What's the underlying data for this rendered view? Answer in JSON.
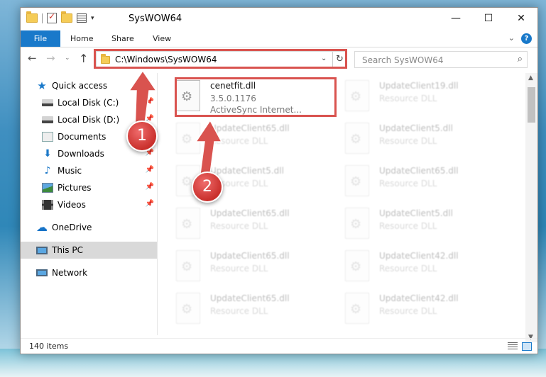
{
  "window": {
    "title": "SysWOW64",
    "controls": {
      "minimize": "—",
      "maximize": "☐",
      "close": "✕"
    }
  },
  "ribbon": {
    "tabs": [
      "File",
      "Home",
      "Share",
      "View"
    ],
    "help": "?"
  },
  "navbar": {
    "address": "C:\\Windows\\SysWOW64",
    "search_placeholder": "Search SysWOW64",
    "icons": [
      "back-arrow-icon",
      "forward-arrow-icon",
      "recent-locations-icon",
      "up-arrow-icon",
      "refresh-icon",
      "search-icon"
    ]
  },
  "sidebar": {
    "items": [
      {
        "label": "Quick access",
        "icon": "star-icon",
        "pinned": false
      },
      {
        "label": "Local Disk (C:)",
        "icon": "drive-icon",
        "pinned": true
      },
      {
        "label": "Local Disk (D:)",
        "icon": "drive-icon",
        "pinned": true
      },
      {
        "label": "Documents",
        "icon": "documents-icon",
        "pinned": true
      },
      {
        "label": "Downloads",
        "icon": "downloads-icon",
        "pinned": true
      },
      {
        "label": "Music",
        "icon": "music-icon",
        "pinned": true
      },
      {
        "label": "Pictures",
        "icon": "pictures-icon",
        "pinned": true
      },
      {
        "label": "Videos",
        "icon": "videos-icon",
        "pinned": true
      },
      {
        "label": "OneDrive",
        "icon": "onedrive-icon",
        "pinned": false
      },
      {
        "label": "This PC",
        "icon": "computer-icon",
        "pinned": false,
        "selected": true
      },
      {
        "label": "Network",
        "icon": "network-icon",
        "pinned": false
      }
    ]
  },
  "files": [
    {
      "name": "cenetfit.dll",
      "version": "3.5.0.1176",
      "description": "ActiveSync Internet...",
      "highlighted": true
    },
    {
      "name": "UpdateClient19.dll",
      "description": "Resource DLL"
    },
    {
      "name": "UpdateClient65.dll",
      "description": "Resource DLL"
    },
    {
      "name": "UpdateClient5.dll",
      "description": "Resource DLL"
    },
    {
      "name": "UpdateClient5.dll",
      "description": "Resource DLL"
    },
    {
      "name": "UpdateClient65.dll",
      "description": "Resource DLL"
    },
    {
      "name": "UpdateClient65.dll",
      "description": "Resource DLL"
    },
    {
      "name": "UpdateClient5.dll",
      "description": "Resource DLL"
    },
    {
      "name": "UpdateClient65.dll",
      "description": "Resource DLL"
    },
    {
      "name": "UpdateClient42.dll",
      "description": "Resource DLL"
    },
    {
      "name": "UpdateClient65.dll",
      "description": "Resource DLL"
    },
    {
      "name": "UpdateClient42.dll",
      "description": "Resource DLL"
    }
  ],
  "status": {
    "item_count": "140 items"
  },
  "annotations": [
    {
      "number": "1"
    },
    {
      "number": "2"
    }
  ],
  "colors": {
    "accent": "#1979ca",
    "annotation": "#d9534f"
  }
}
